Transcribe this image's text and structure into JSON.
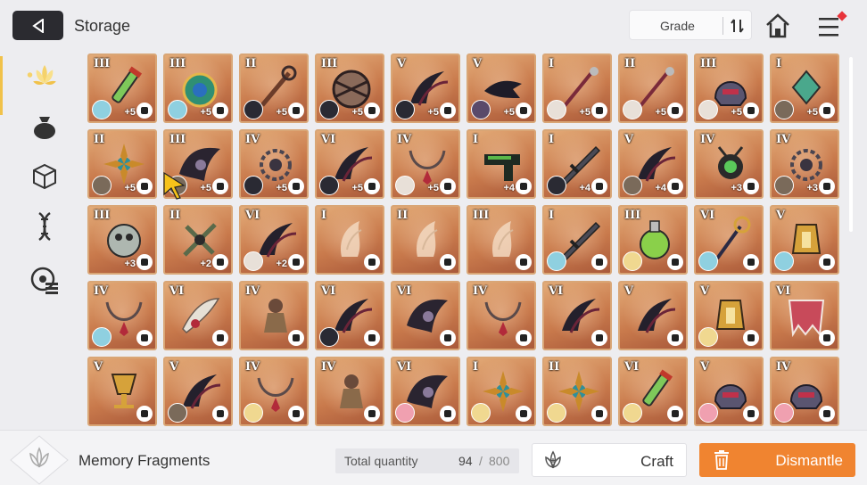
{
  "header": {
    "title": "Storage",
    "sort_label": "Grade"
  },
  "sidebar": {
    "items": [
      {
        "icon": "lotus-icon",
        "active": true
      },
      {
        "icon": "pouch-icon",
        "active": false
      },
      {
        "icon": "cube-icon",
        "active": false
      },
      {
        "icon": "dna-icon",
        "active": false
      },
      {
        "icon": "disc-list-icon",
        "active": false
      }
    ]
  },
  "grid": {
    "items": [
      {
        "grade": "III",
        "upgrade": "+5",
        "art": "vial",
        "portrait": "#8fd0e0"
      },
      {
        "grade": "III",
        "upgrade": "+5",
        "art": "orb",
        "portrait": "#8fd0e0"
      },
      {
        "grade": "II",
        "upgrade": "+5",
        "art": "key",
        "portrait": "#2a2a33"
      },
      {
        "grade": "III",
        "upgrade": "+5",
        "art": "cage",
        "portrait": "#2a2a33"
      },
      {
        "grade": "V",
        "upgrade": "+5",
        "art": "claw",
        "portrait": "#2a2a33"
      },
      {
        "grade": "V",
        "upgrade": "+5",
        "art": "crow",
        "portrait": "#5a4a6a"
      },
      {
        "grade": "I",
        "upgrade": "+5",
        "art": "staff",
        "portrait": "#e8e0d8"
      },
      {
        "grade": "II",
        "upgrade": "+5",
        "art": "staff",
        "portrait": "#e8e0d8"
      },
      {
        "grade": "III",
        "upgrade": "+5",
        "art": "helm",
        "portrait": "#e8e0d8"
      },
      {
        "grade": "I",
        "upgrade": "+5",
        "art": "gem",
        "portrait": "#7a6a5a"
      },
      {
        "grade": "II",
        "upgrade": "+5",
        "art": "flower",
        "portrait": "#7a6a5a"
      },
      {
        "grade": "III",
        "upgrade": "+5",
        "art": "wing",
        "portrait": "#7a6a5a"
      },
      {
        "grade": "IV",
        "upgrade": "+5",
        "art": "chain",
        "portrait": "#2a2a33"
      },
      {
        "grade": "VI",
        "upgrade": "+5",
        "art": "claw",
        "portrait": "#2a2a33"
      },
      {
        "grade": "IV",
        "upgrade": "+5",
        "art": "necklace",
        "portrait": "#e8e0d8"
      },
      {
        "grade": "I",
        "upgrade": "+4",
        "art": "gun",
        "portrait": ""
      },
      {
        "grade": "I",
        "upgrade": "+4",
        "art": "blade",
        "portrait": "#2a2a33"
      },
      {
        "grade": "V",
        "upgrade": "+4",
        "art": "claw",
        "portrait": "#7a6a5a"
      },
      {
        "grade": "IV",
        "upgrade": "+3",
        "art": "device",
        "portrait": ""
      },
      {
        "grade": "IV",
        "upgrade": "+3",
        "art": "chain",
        "portrait": "#7a6a5a"
      },
      {
        "grade": "III",
        "upgrade": "+3",
        "art": "robot",
        "portrait": ""
      },
      {
        "grade": "II",
        "upgrade": "+2",
        "art": "cross",
        "portrait": ""
      },
      {
        "grade": "VI",
        "upgrade": "+2",
        "art": "claw",
        "portrait": "#e8e0d8"
      },
      {
        "grade": "I",
        "upgrade": "",
        "art": "pale",
        "portrait": ""
      },
      {
        "grade": "II",
        "upgrade": "",
        "art": "pale",
        "portrait": ""
      },
      {
        "grade": "III",
        "upgrade": "",
        "art": "pale",
        "portrait": ""
      },
      {
        "grade": "I",
        "upgrade": "",
        "art": "blade",
        "portrait": "#8fd0e0"
      },
      {
        "grade": "III",
        "upgrade": "",
        "art": "potion",
        "portrait": "#f0d890"
      },
      {
        "grade": "VI",
        "upgrade": "",
        "art": "wand",
        "portrait": "#8fd0e0"
      },
      {
        "grade": "V",
        "upgrade": "",
        "art": "lantern",
        "portrait": "#8fd0e0"
      },
      {
        "grade": "IV",
        "upgrade": "",
        "art": "necklace",
        "portrait": "#8fd0e0"
      },
      {
        "grade": "VI",
        "upgrade": "",
        "art": "feather",
        "portrait": ""
      },
      {
        "grade": "IV",
        "upgrade": "",
        "art": "doll",
        "portrait": ""
      },
      {
        "grade": "VI",
        "upgrade": "",
        "art": "claw",
        "portrait": "#2a2a33"
      },
      {
        "grade": "VI",
        "upgrade": "",
        "art": "wing",
        "portrait": ""
      },
      {
        "grade": "IV",
        "upgrade": "",
        "art": "necklace",
        "portrait": ""
      },
      {
        "grade": "VI",
        "upgrade": "",
        "art": "claw",
        "portrait": ""
      },
      {
        "grade": "V",
        "upgrade": "",
        "art": "claw",
        "portrait": ""
      },
      {
        "grade": "V",
        "upgrade": "",
        "art": "lantern",
        "portrait": "#f0d890"
      },
      {
        "grade": "VI",
        "upgrade": "",
        "art": "cape",
        "portrait": ""
      },
      {
        "grade": "V",
        "upgrade": "",
        "art": "chalice",
        "portrait": ""
      },
      {
        "grade": "V",
        "upgrade": "",
        "art": "claw",
        "portrait": "#7a6a5a"
      },
      {
        "grade": "IV",
        "upgrade": "",
        "art": "necklace",
        "portrait": "#f0d890"
      },
      {
        "grade": "IV",
        "upgrade": "",
        "art": "doll",
        "portrait": ""
      },
      {
        "grade": "VI",
        "upgrade": "",
        "art": "wing",
        "portrait": "#f0a0b0"
      },
      {
        "grade": "I",
        "upgrade": "",
        "art": "flower",
        "portrait": "#f0d890"
      },
      {
        "grade": "II",
        "upgrade": "",
        "art": "flower",
        "portrait": "#f0d890"
      },
      {
        "grade": "VI",
        "upgrade": "",
        "art": "vial",
        "portrait": "#f0d890"
      },
      {
        "grade": "V",
        "upgrade": "",
        "art": "helm",
        "portrait": "#f0a0b0"
      },
      {
        "grade": "IV",
        "upgrade": "",
        "art": "helm",
        "portrait": "#f0a0b0"
      }
    ]
  },
  "footer": {
    "fragments_label": "Memory Fragments",
    "total_label": "Total quantity",
    "quantity_current": "94",
    "quantity_sep": "/",
    "quantity_max": "800",
    "craft_label": "Craft",
    "dismantle_label": "Dismantle"
  },
  "colors": {
    "accent_orange": "#f08430",
    "back_button": "#2b2b30",
    "active_rail": "#f1c24a"
  }
}
